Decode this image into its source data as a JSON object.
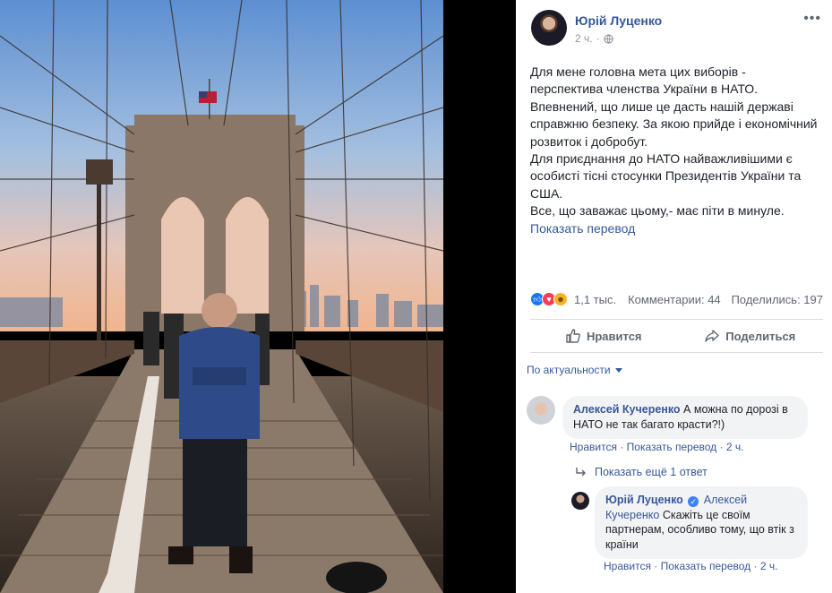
{
  "post": {
    "author": "Юрій Луценко",
    "time": "2 ч.",
    "privacy_icon": "globe-icon",
    "more_icon": "more-options-icon",
    "text": [
      "Для мене головна мета цих виборів - перспектива членства України в НАТО.",
      "Впевнений, що лише це дасть нашій державі справжню безпеку. За якою прийде і економічний розвиток і добробут.",
      "Для приєднання до НАТО найважливішими є особисті тісні стосунки Президентів України та США.",
      "Все, що заважає цьому,- має піти в минуле."
    ],
    "see_translation": "Показать перевод"
  },
  "reactions": {
    "icons": [
      "like-reaction-icon",
      "love-reaction-icon",
      "haha-reaction-icon"
    ],
    "count": "1,1 тыс.",
    "comments": "Комментарии: 44",
    "shares": "Поделились: 197"
  },
  "actions": {
    "like": "Нравится",
    "share": "Поделиться"
  },
  "sort_label": "По актуальности",
  "comments": [
    {
      "name": "Алексей Кучеренко",
      "text": "А можна по дорозі в НАТО не так багато красти?!)",
      "like": "Нравится",
      "translate": "Показать перевод",
      "time": "2 ч.",
      "sep": "·"
    }
  ],
  "more_replies": "Показать ещё 1 ответ",
  "reply": {
    "name": "Юрій Луценко",
    "mention": "Алексей Кучеренко",
    "text": "Скажіть це своїм партнерам, особливо тому, що втік з країни",
    "like": "Нравится",
    "translate": "Показать перевод",
    "time": "2 ч.",
    "sep": "·"
  },
  "colors": {
    "link": "#365899",
    "meta": "#90949c",
    "bubble": "#f2f3f5",
    "like_blue": "#1877f2"
  }
}
